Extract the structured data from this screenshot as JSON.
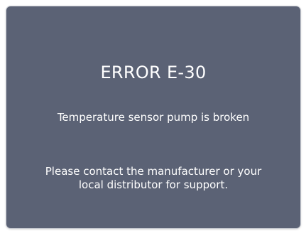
{
  "dialog": {
    "title": "ERROR E-30",
    "message": "Temperature sensor pump is broken",
    "support_text": "Please contact the manufacturer or your local distributor for support."
  },
  "colors": {
    "dialog_background": "#5b6275",
    "text": "#ffffff"
  }
}
